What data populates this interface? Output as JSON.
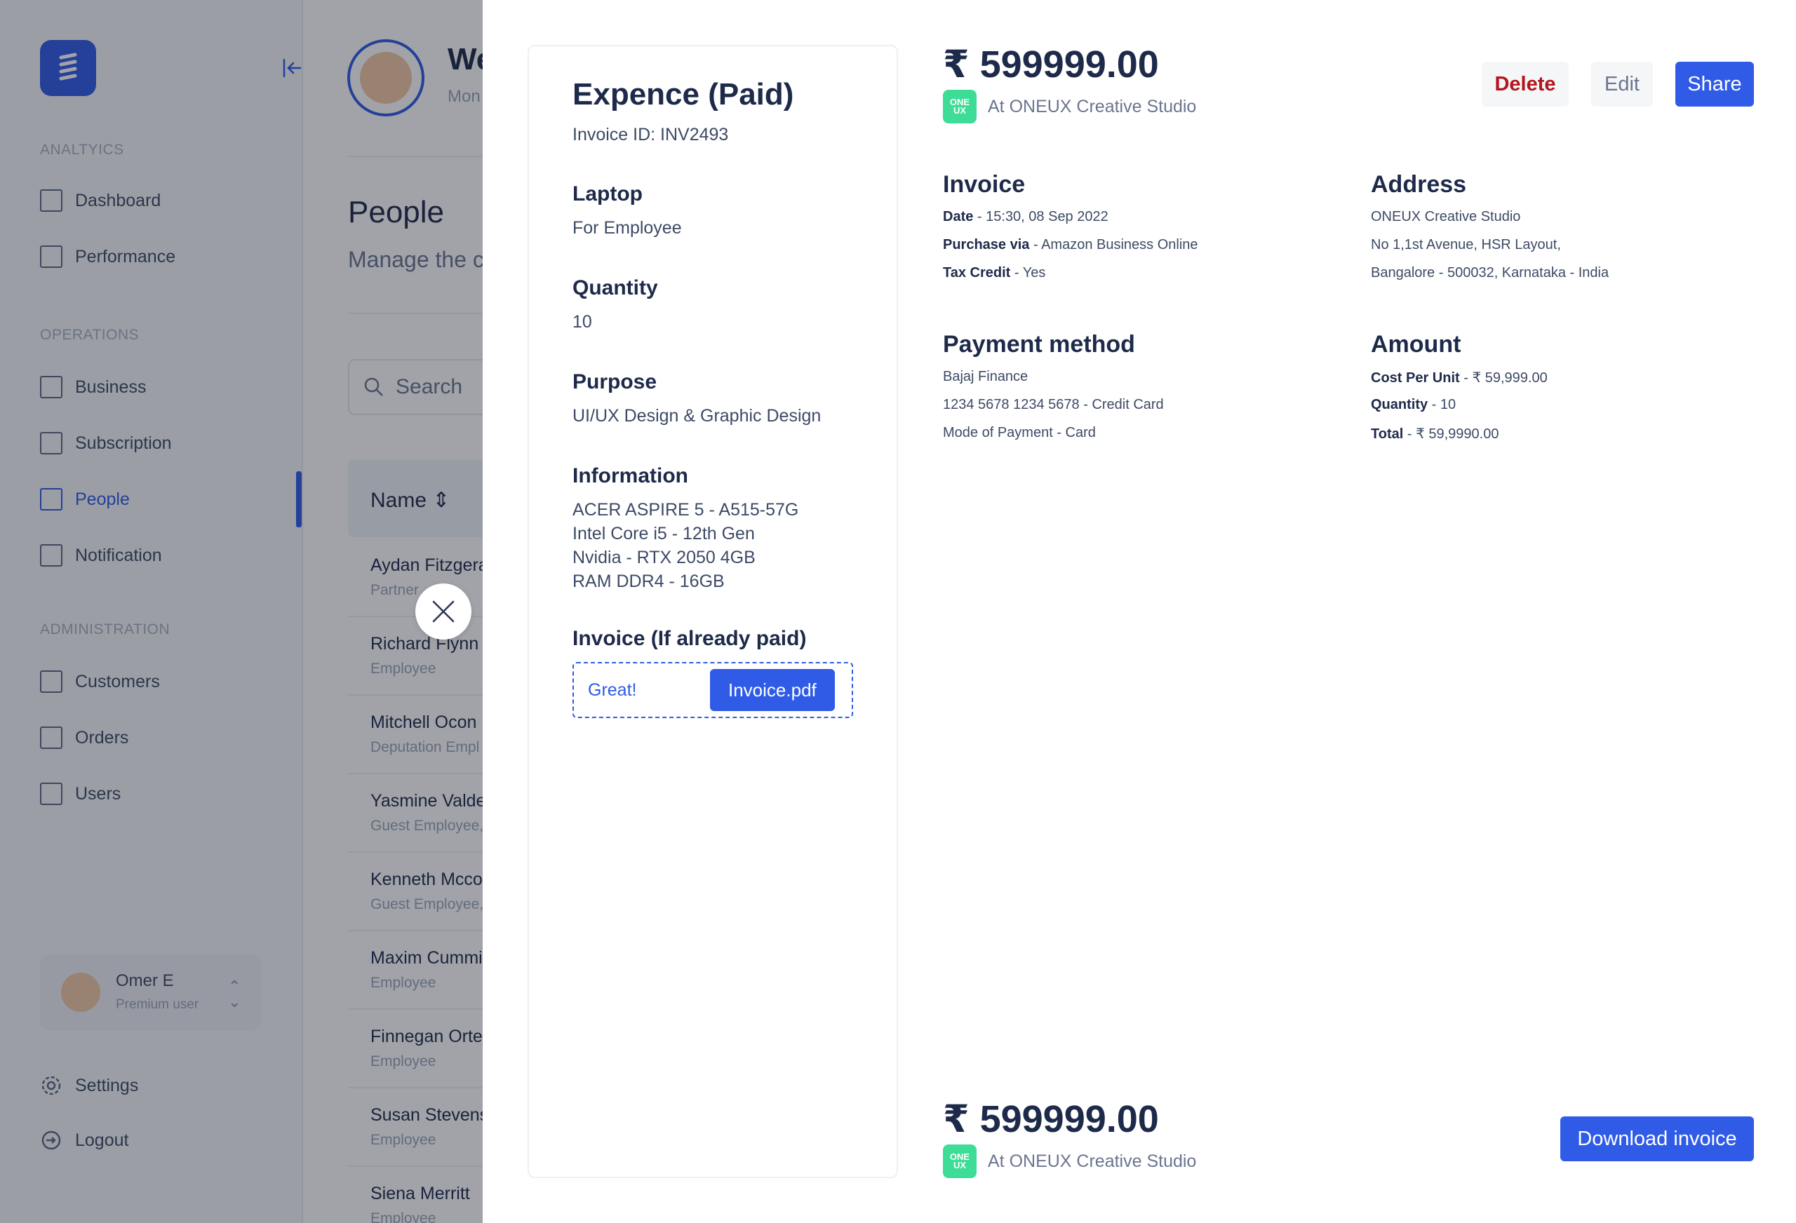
{
  "sidebar": {
    "sections": {
      "analytics": "ANALTYICS",
      "operations": "OPERATIONS",
      "administration": "ADMINISTRATION"
    },
    "items": {
      "dashboard": "Dashboard",
      "performance": "Performance",
      "business": "Business",
      "subscription": "Subscription",
      "people": "People",
      "notification": "Notification",
      "customers": "Customers",
      "orders": "Orders",
      "users": "Users"
    },
    "user": {
      "name": "Omer E",
      "role": "Premium user"
    },
    "settings": "Settings",
    "logout": "Logout"
  },
  "header": {
    "welcome": "We",
    "subtitle": "Mon"
  },
  "page": {
    "title": "People",
    "subtitle": "Manage the c",
    "search_placeholder": "Search",
    "name_column": "Name"
  },
  "people_rows": [
    {
      "name": "Aydan Fitzgera",
      "role": "Partner"
    },
    {
      "name": "Richard Flynn",
      "role": "Employee"
    },
    {
      "name": "Mitchell Ocon",
      "role": "Deputation Empl"
    },
    {
      "name": "Yasmine Valde",
      "role": "Guest Employee,"
    },
    {
      "name": "Kenneth Mcco",
      "role": "Guest Employee,"
    },
    {
      "name": "Maxim Cummi",
      "role": "Employee"
    },
    {
      "name": "Finnegan Orte",
      "role": "Employee"
    },
    {
      "name": "Susan Stevens",
      "role": "Employee"
    },
    {
      "name": "Siena Merritt",
      "role": "Employee"
    }
  ],
  "expense": {
    "title": "Expence (Paid)",
    "invoice_id": "Invoice ID: INV2493",
    "fields": [
      {
        "label": "Laptop",
        "value": "For Employee"
      },
      {
        "label": "Quantity",
        "value": "10"
      },
      {
        "label": "Purpose",
        "value": "UI/UX Design & Graphic Design"
      }
    ],
    "information_label": "Information",
    "information_lines": [
      "ACER ASPIRE 5 - A515-57G",
      "Intel Core i5 - 12th Gen",
      "Nvidia - RTX 2050 4GB",
      "RAM DDR4 - 16GB"
    ],
    "invoice_label": "Invoice (If already paid)",
    "upload_status": "Great!",
    "invoice_file": "Invoice.pdf"
  },
  "summary": {
    "amount": "₹ 599999.00",
    "store": "At ONEUX Creative Studio",
    "store_badge_top": "ONE",
    "store_badge_bottom": "UX",
    "store_badge_color": "#3ddc97"
  },
  "actions": {
    "delete": "Delete",
    "edit": "Edit",
    "share": "Share",
    "download": "Download invoice"
  },
  "invoice": {
    "title": "Invoice",
    "date_label": "Date",
    "date_value": " - 15:30, 08 Sep 2022",
    "purchase_label": "Purchase via",
    "purchase_value": " - Amazon Business Online",
    "tax_label": "Tax Credit",
    "tax_value": " - Yes"
  },
  "address": {
    "title": "Address",
    "lines": [
      "ONEUX Creative Studio",
      "No 1,1st Avenue, HSR Layout,",
      "Bangalore -  500032, Karnataka - India"
    ]
  },
  "payment": {
    "title": "Payment method",
    "lines": [
      "Bajaj Finance",
      "1234 5678 1234 5678 - Credit Card",
      "Mode of Payment - Card"
    ]
  },
  "amount_section": {
    "title": "Amount",
    "cost_label": "Cost Per Unit",
    "cost_value": " - ₹ 59,999.00",
    "qty_label": "Quantity",
    "qty_value": " - 10",
    "total_label": "Total",
    "total_value": " - ₹ 59,9990.00"
  },
  "colors": {
    "accent": "#2f5be7",
    "danger": "#b3151c",
    "text": "#1e2a4a"
  }
}
